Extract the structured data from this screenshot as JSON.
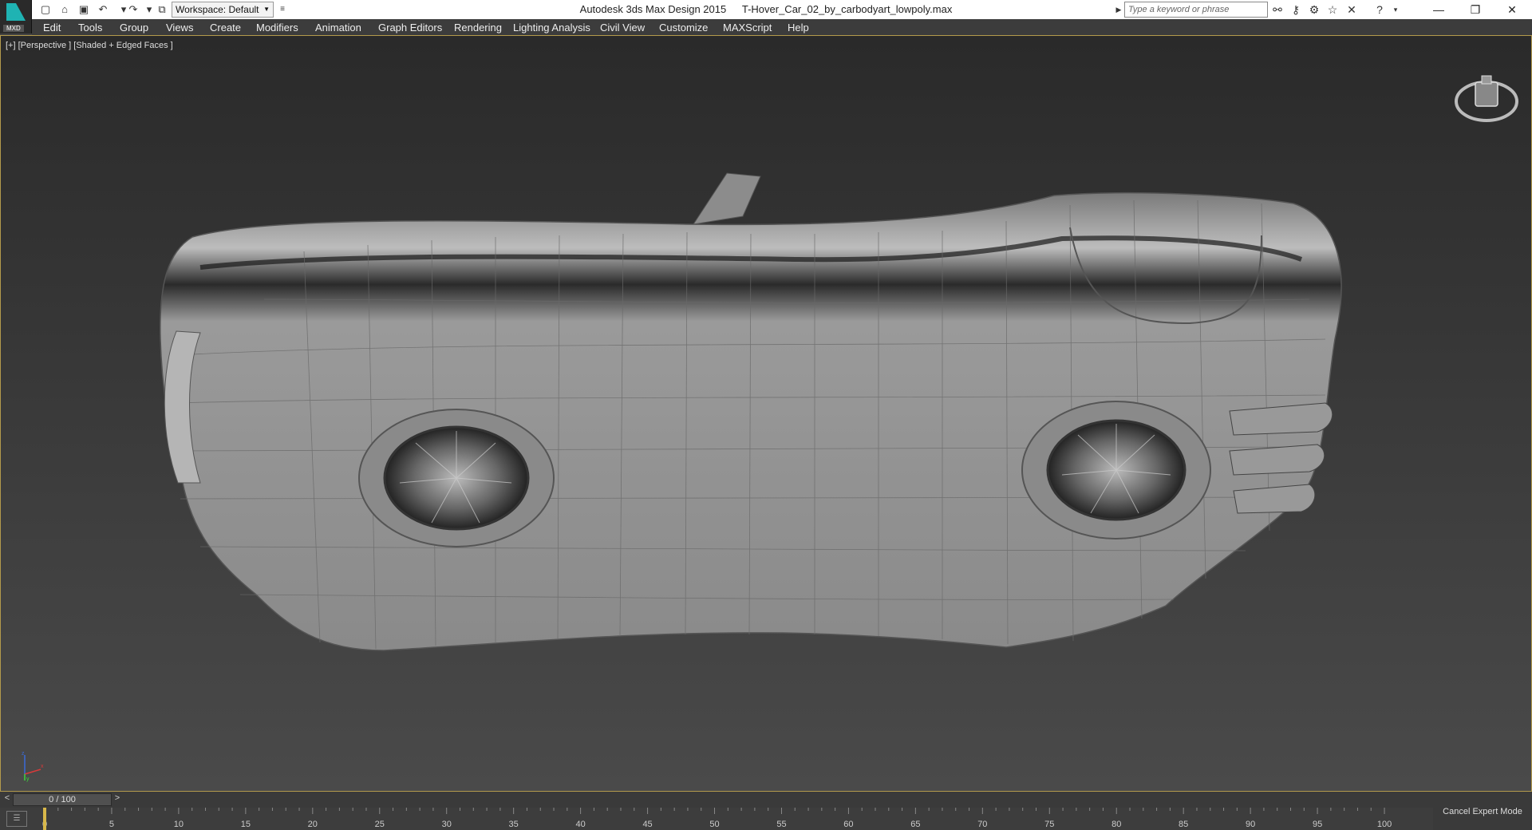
{
  "app": {
    "logo_label": "MXD",
    "title": "Autodesk 3ds Max Design 2015",
    "file": "T-Hover_Car_02_by_carbodyart_lowpoly.max",
    "workspace": "Workspace: Default",
    "search_placeholder": "Type a keyword or phrase"
  },
  "quick_access": {
    "icons": [
      "new-file-icon",
      "open-file-icon",
      "save-icon",
      "undo-icon",
      "redo-icon",
      "project-folder-icon"
    ]
  },
  "toolbar_icons": [
    "binoculars-icon",
    "key-icon",
    "tools-icon",
    "star-icon",
    "x-exchange-icon",
    "help-icon"
  ],
  "window_controls": {
    "minimize": "—",
    "restore": "❐",
    "close": "✕"
  },
  "menu": [
    "Edit",
    "Tools",
    "Group",
    "Views",
    "Create",
    "Modifiers",
    "Animation",
    "Graph Editors",
    "Rendering",
    "Lighting Analysis",
    "Civil View",
    "Customize",
    "MAXScript",
    "Help"
  ],
  "viewport": {
    "label": "[+] [Perspective ] [Shaded + Edged Faces ]",
    "axis_labels": {
      "z": "z",
      "y": "y",
      "x": "x"
    }
  },
  "timeline": {
    "prev": "<",
    "next": ">",
    "frame": "0 / 100",
    "ticks": [
      "0",
      "5",
      "10",
      "15",
      "20",
      "25",
      "30",
      "35",
      "40",
      "45",
      "50",
      "55",
      "60",
      "65",
      "70",
      "75",
      "80",
      "85",
      "90",
      "95",
      "100"
    ],
    "cancel_expert_mode": "Cancel Expert Mode"
  },
  "colors": {
    "viewport_border": "#b39a4c",
    "menubar_bg": "#3c3c3c",
    "logo_accent": "#1fb3b3",
    "model_gray": "#8c8c8c"
  }
}
